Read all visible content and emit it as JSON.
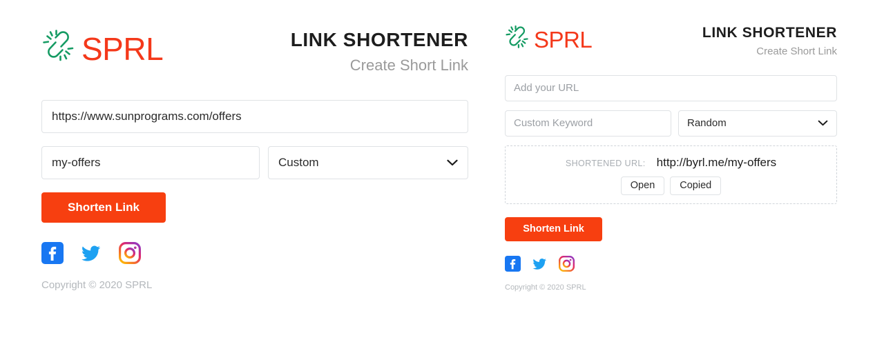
{
  "theme": {
    "brand_orange": "#f4381a",
    "button_orange": "#f73f10",
    "logo_green": "#159b63",
    "border_gray": "#dfe2e5",
    "muted_gray": "#9a9a9a",
    "background": "#ffffff"
  },
  "left_panel": {
    "brand": {
      "icon": "link-burst-logo-icon",
      "word": "SPRL"
    },
    "title": "LINK SHORTENER",
    "subtitle": "Create Short Link",
    "url_input": {
      "value": "https://www.sunprograms.com/offers",
      "placeholder": "Add your URL"
    },
    "keyword_input": {
      "value": "my-offers",
      "placeholder": "Custom Keyword"
    },
    "mode_select": {
      "value": "Custom",
      "options": [
        "Random",
        "Custom"
      ],
      "icon": "chevron-down-icon"
    },
    "submit_label": "Shorten Link",
    "social": [
      {
        "name": "facebook",
        "label": "Facebook"
      },
      {
        "name": "twitter",
        "label": "Twitter"
      },
      {
        "name": "instagram",
        "label": "Instagram"
      }
    ],
    "copyright": "Copyright © 2020 SPRL"
  },
  "right_panel": {
    "brand": {
      "icon": "link-burst-logo-icon",
      "word": "SPRL"
    },
    "title": "LINK SHORTENER",
    "subtitle": "Create Short Link",
    "url_input": {
      "value": "",
      "placeholder": "Add your URL"
    },
    "keyword_input": {
      "value": "",
      "placeholder": "Custom Keyword"
    },
    "mode_select": {
      "value": "Random",
      "options": [
        "Random",
        "Custom"
      ],
      "icon": "chevron-down-icon"
    },
    "result": {
      "label": "SHORTENED URL:",
      "url": "http://byrl.me/my-offers",
      "open_label": "Open",
      "copy_label": "Copied"
    },
    "submit_label": "Shorten Link",
    "social": [
      {
        "name": "facebook",
        "label": "Facebook"
      },
      {
        "name": "twitter",
        "label": "Twitter"
      },
      {
        "name": "instagram",
        "label": "Instagram"
      }
    ],
    "copyright": "Copyright © 2020 SPRL"
  }
}
